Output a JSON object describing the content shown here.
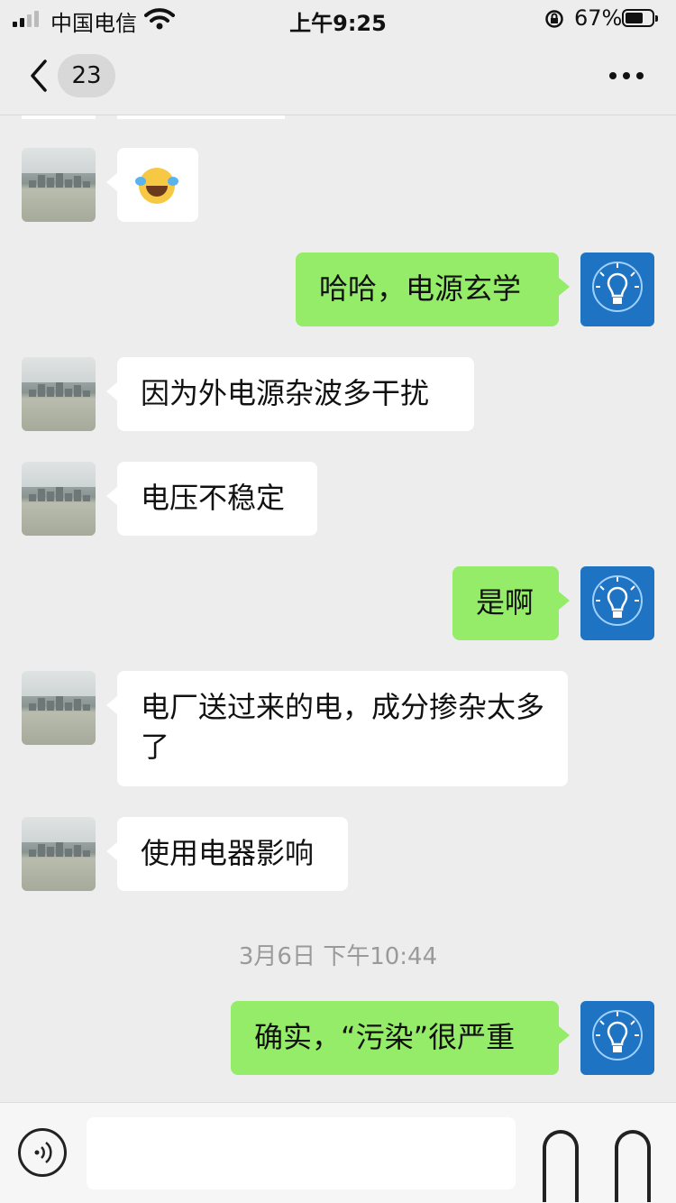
{
  "status_bar": {
    "carrier": "中国电信",
    "time": "上午9:25",
    "battery_percent": "67%",
    "battery_level": 0.67
  },
  "nav": {
    "back_icon": "chevron-left-icon",
    "unread_count": "23",
    "more_icon": "more-dots-icon"
  },
  "messages": [
    {
      "side": "in",
      "type": "emoji",
      "emoji": "😂"
    },
    {
      "side": "out",
      "text": "哈哈，电源玄学"
    },
    {
      "side": "in",
      "text": "因为外电源杂波多干扰"
    },
    {
      "side": "in",
      "text": "电压不稳定"
    },
    {
      "side": "out",
      "text": "是啊"
    },
    {
      "side": "in",
      "text": "电厂送过来的电，成分掺杂太多了"
    },
    {
      "side": "in",
      "text": "使用电器影响"
    },
    {
      "side": "out",
      "text": "确实，“污染”很严重"
    }
  ],
  "timestamp": "3月6日 下午10:44",
  "colors": {
    "background": "#ededed",
    "incoming_bubble": "#ffffff",
    "outgoing_bubble": "#95ec69",
    "avatar_self": "#1e73c2"
  },
  "input_bar": {
    "voice_icon": "voice-icon",
    "message_value": "",
    "emoji_icon": "emoji-icon",
    "plus_icon": "plus-icon"
  }
}
